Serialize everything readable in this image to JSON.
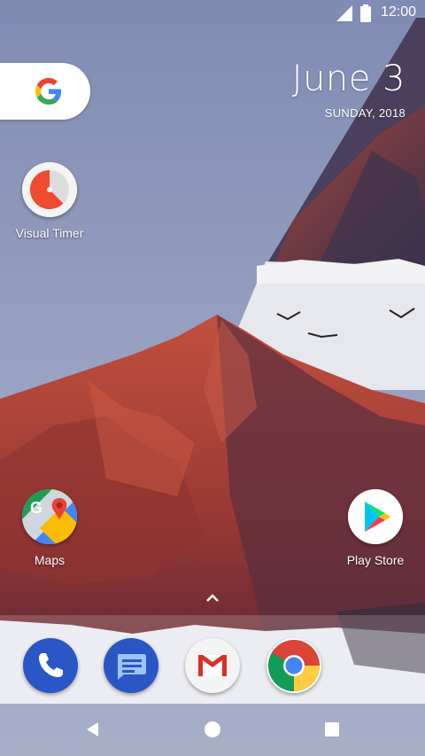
{
  "status": {
    "time": "12:00"
  },
  "date_widget": {
    "date": "June 3",
    "day": "SUNDAY, 2018"
  },
  "apps": {
    "visual_timer": "Visual Timer",
    "maps": "Maps",
    "play_store": "Play Store"
  },
  "dock": [
    "phone-icon",
    "messages-icon",
    "gmail-icon",
    "chrome-icon"
  ],
  "colors": {
    "sky": "#8a94b8",
    "mountain": "#b5463c",
    "dock_phone": "#2a56c6"
  }
}
